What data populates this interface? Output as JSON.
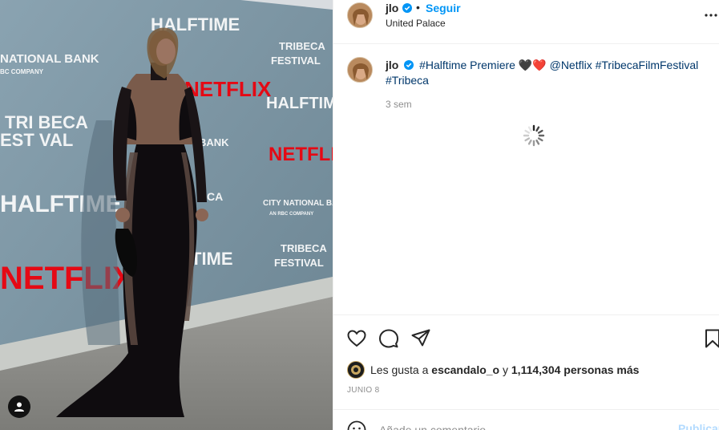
{
  "post": {
    "username": "jlo",
    "verified": true,
    "separator": "•",
    "follow_label": "Seguir",
    "location": "United Palace"
  },
  "caption": {
    "username": "jlo",
    "text_prefix": "#Halftime Premiere",
    "hearts": "🖤❤️",
    "tags": [
      "@Netflix",
      "#TribecaFilmFestival",
      "#Tribeca"
    ],
    "time_ago": "3 sem"
  },
  "photo": {
    "backdrop_texts": {
      "halftime": "HALFTIME",
      "netflix": "NETFLIX",
      "tribeca": "TRIBECA",
      "festival": "FESTIVAL",
      "city_bank": "CITY NATIONAL BANK",
      "rbc": "AN RBC COMPANY",
      "bank": "BANK",
      "national_bank": "NATIONAL BANK",
      "bc_company": "BC COMPANY",
      "tri_beca": "TRI BECA",
      "est_val": "EST VAL",
      "time": "TIME",
      "ca": "CA"
    }
  },
  "likes": {
    "prefix": "Les gusta a",
    "user": "escandalo_o",
    "middle": "y",
    "count": "1,114,304",
    "suffix": "personas más"
  },
  "date": "JUNIO 8",
  "comment": {
    "placeholder": "Añade un comentario...",
    "publish_label": "Publicar"
  },
  "icons": {
    "like": "heart-icon",
    "comment": "comment-icon",
    "share": "paper-plane-icon",
    "save": "bookmark-icon",
    "more": "more-horizontal-icon",
    "tag": "user-tag-icon",
    "emoji": "emoji-icon",
    "loading": "spinner-icon"
  },
  "colors": {
    "link_blue": "#0095f6",
    "tag_blue": "#00376b",
    "muted": "#8e8e8e",
    "netflix_red": "#e50914",
    "backdrop": "#7c95a3"
  }
}
